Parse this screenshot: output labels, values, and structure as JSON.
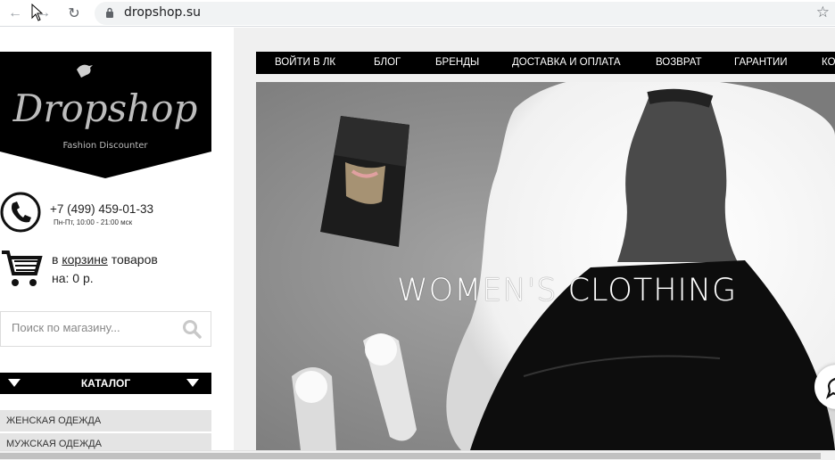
{
  "browser": {
    "url": "dropshop.su",
    "back_icon": "arrow-left-icon",
    "forward_icon": "arrow-right-icon",
    "reload_icon": "reload-icon",
    "star_icon": "star-icon"
  },
  "logo": {
    "name": "Dropshop",
    "tagline": "Fashion Discounter"
  },
  "contact": {
    "phone": "+7 (499) 459-01-33",
    "hours": "Пн-Пт, 10:00 - 21:00 мск"
  },
  "cart": {
    "prefix": "в",
    "link": "корзине",
    "suffix": "товаров",
    "total_label": "на: 0 р."
  },
  "search": {
    "placeholder": "Поиск по магазину..."
  },
  "catalog": {
    "title": "КАТАЛОГ",
    "items": [
      "ЖЕНСКАЯ ОДЕЖДА",
      "МУЖСКАЯ ОДЕЖДА"
    ]
  },
  "topnav": {
    "items": [
      "ВОЙТИ В ЛК",
      "БЛОГ",
      "БРЕНДЫ",
      "ДОСТАВКА И ОПЛАТА",
      "ВОЗВРАТ",
      "ГАРАНТИИ",
      "КО"
    ]
  },
  "hero": {
    "title": "WOMEN'S CLOTHING"
  },
  "colors": {
    "nav_bg": "#000000",
    "catalog_item_bg": "#e4e4e4",
    "hero_bg": "#8f8f8f"
  }
}
